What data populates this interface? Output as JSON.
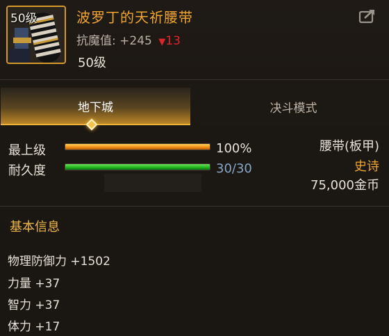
{
  "item": {
    "level_badge": "50级",
    "name": "波罗丁的天祈腰带",
    "stat_label": "抗魔值:",
    "stat_value": "+245",
    "stat_change": "13",
    "level_text": "50级"
  },
  "tabs": [
    {
      "label": "地下城",
      "active": true
    },
    {
      "label": "决斗模式",
      "active": false
    }
  ],
  "bars": {
    "grade": {
      "label": "最上级",
      "value_text": "100%",
      "fill_fraction": 1.0
    },
    "durability": {
      "label": "耐久度",
      "value_text": "30/30",
      "fill_fraction": 1.0
    }
  },
  "info": {
    "type": "腰带(板甲)",
    "rarity": "史诗",
    "price": "75,000金币"
  },
  "basic": {
    "title": "基本信息",
    "attributes": [
      "物理防御力 +1502",
      "力量 +37",
      "智力 +37",
      "体力 +17"
    ]
  },
  "colors": {
    "rarity": "#f0a531",
    "decrease": "#e3232b",
    "accent": "#f0b238"
  }
}
